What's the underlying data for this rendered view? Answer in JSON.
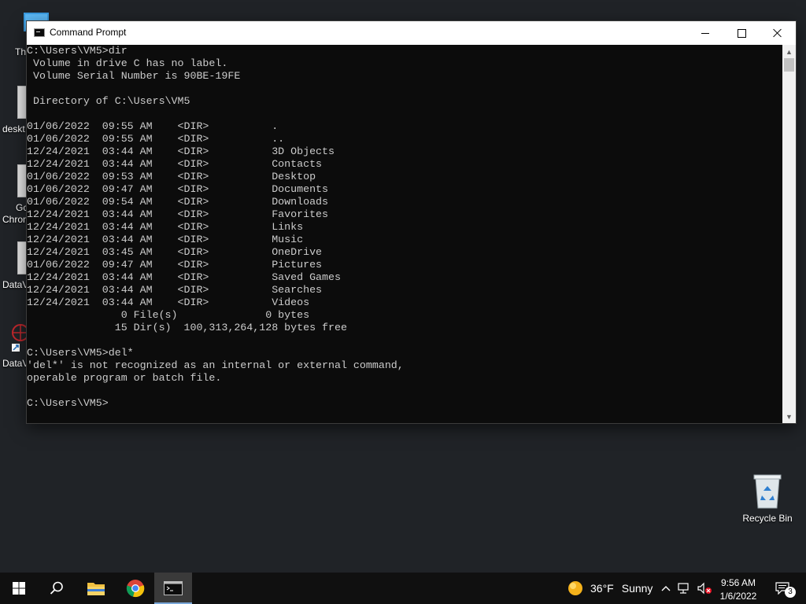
{
  "desktop": {
    "icons": [
      {
        "label": "Thi"
      },
      {
        "label": "deskt"
      },
      {
        "label": "Gc"
      },
      {
        "label": "Chron"
      },
      {
        "label": "DataV"
      },
      {
        "label": "DataV"
      }
    ],
    "recycle_bin": {
      "label": "Recycle Bin"
    }
  },
  "window": {
    "title": "Command Prompt",
    "buttons": {
      "minimize": "minimize",
      "maximize": "maximize",
      "close": "close"
    },
    "console_lines": [
      "C:\\Users\\VM5>dir",
      " Volume in drive C has no label.",
      " Volume Serial Number is 90BE-19FE",
      "",
      " Directory of C:\\Users\\VM5",
      "",
      "01/06/2022  09:55 AM    <DIR>          .",
      "01/06/2022  09:55 AM    <DIR>          ..",
      "12/24/2021  03:44 AM    <DIR>          3D Objects",
      "12/24/2021  03:44 AM    <DIR>          Contacts",
      "01/06/2022  09:53 AM    <DIR>          Desktop",
      "01/06/2022  09:47 AM    <DIR>          Documents",
      "01/06/2022  09:54 AM    <DIR>          Downloads",
      "12/24/2021  03:44 AM    <DIR>          Favorites",
      "12/24/2021  03:44 AM    <DIR>          Links",
      "12/24/2021  03:44 AM    <DIR>          Music",
      "12/24/2021  03:45 AM    <DIR>          OneDrive",
      "01/06/2022  09:47 AM    <DIR>          Pictures",
      "12/24/2021  03:44 AM    <DIR>          Saved Games",
      "12/24/2021  03:44 AM    <DIR>          Searches",
      "12/24/2021  03:44 AM    <DIR>          Videos",
      "               0 File(s)              0 bytes",
      "              15 Dir(s)  100,313,264,128 bytes free",
      "",
      "C:\\Users\\VM5>del*",
      "'del*' is not recognized as an internal or external command,",
      "operable program or batch file.",
      "",
      "C:\\Users\\VM5>"
    ]
  },
  "taskbar": {
    "weather": {
      "temp": "36°F",
      "condition": "Sunny"
    },
    "clock": {
      "time": "9:56 AM",
      "date": "1/6/2022"
    },
    "notifications_count": "3",
    "apps": [
      "start",
      "search",
      "file-explorer",
      "chrome",
      "command-prompt"
    ]
  },
  "colors": {
    "desktop_bg": "#202327",
    "console_bg": "#0c0c0c",
    "console_fg": "#cccccc",
    "taskbar_bg": "#101010",
    "accent": "#7aa7d8"
  }
}
